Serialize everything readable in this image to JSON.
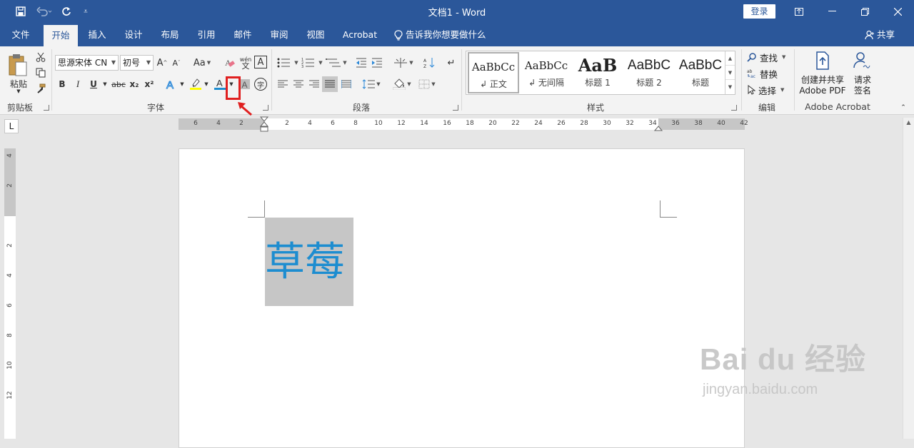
{
  "title_bar": {
    "document_title": "文档1  -  Word",
    "login_label": "登录"
  },
  "tabs": [
    {
      "label": "文件"
    },
    {
      "label": "开始",
      "active": true
    },
    {
      "label": "插入"
    },
    {
      "label": "设计"
    },
    {
      "label": "布局"
    },
    {
      "label": "引用"
    },
    {
      "label": "邮件"
    },
    {
      "label": "审阅"
    },
    {
      "label": "视图"
    },
    {
      "label": "Acrobat"
    }
  ],
  "tell_me": "告诉我你想要做什么",
  "share_label": "共享",
  "ribbon": {
    "clipboard": {
      "paste_label": "粘贴",
      "group_label": "剪贴板"
    },
    "font": {
      "font_name": "思源宋体 CN",
      "font_size": "初号",
      "group_label": "字体",
      "change_case": "Aa",
      "bold": "B",
      "italic": "I",
      "underline": "U",
      "strike": "abc",
      "subscript": "x₂",
      "superscript": "x²",
      "font_color_glyph": "A",
      "grow_glyph": "A",
      "shrink_glyph": "A",
      "char_border": "A",
      "phonetic": "wén",
      "enclose": "字"
    },
    "paragraph": {
      "group_label": "段落"
    },
    "styles": {
      "group_label": "样式",
      "items": [
        {
          "sample": "AaBbCc",
          "name": "↲ 正文"
        },
        {
          "sample": "AaBbCc",
          "name": "↲ 无间隔"
        },
        {
          "sample": "AaB",
          "name": "标题 1"
        },
        {
          "sample": "AaBbC",
          "name": "标题 2"
        },
        {
          "sample": "AaBbC",
          "name": "标题"
        }
      ]
    },
    "editing": {
      "group_label": "编辑",
      "find": "查找",
      "replace": "替换",
      "select": "选择"
    },
    "acrobat": {
      "group_label": "Adobe Acrobat",
      "create_pdf": "创建并共享 Adobe PDF",
      "request_sign": "请求签名"
    }
  },
  "ruler": {
    "corner": "L",
    "h_labels": [
      "6",
      "4",
      "2",
      "2",
      "4",
      "6",
      "8",
      "10",
      "12",
      "14",
      "16",
      "18",
      "20",
      "22",
      "24",
      "26",
      "28",
      "30",
      "32",
      "34",
      "36",
      "38",
      "40",
      "42"
    ],
    "v_labels": [
      "4",
      "2",
      "2",
      "4",
      "6",
      "8",
      "10",
      "12"
    ]
  },
  "document": {
    "text": "草莓",
    "text_color": "#1d8dd0",
    "highlight_color": "#c6c6c6"
  },
  "watermark": {
    "main": "Bai du 经验",
    "sub": "jingyan.baidu.com"
  },
  "colors": {
    "brand": "#2b579a",
    "annotation_red": "#e02020",
    "highlighter_yellow": "#ffff00",
    "font_color_bar": "#1d8dd0"
  }
}
